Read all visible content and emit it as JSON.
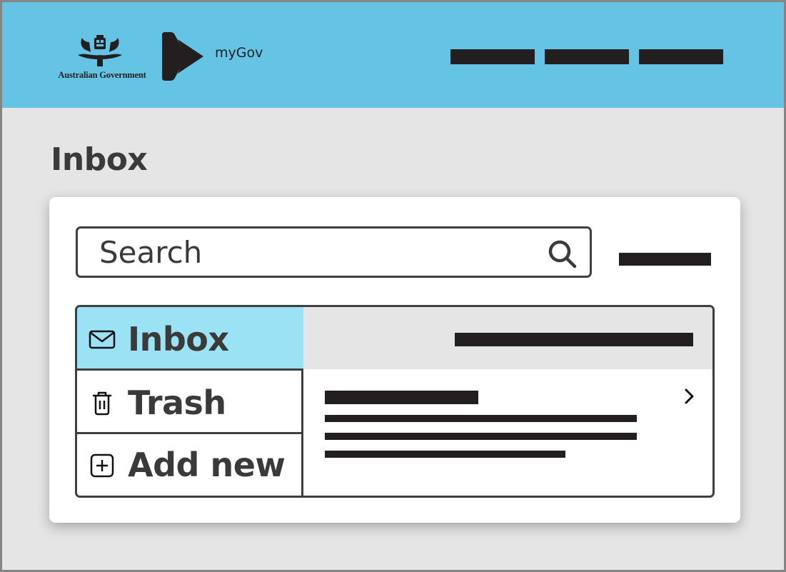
{
  "header": {
    "government_label": "Australian Government",
    "brand_name": "myGov",
    "background_color": "#65c4e4",
    "nav_items": [
      {
        "icon": "redacted-nav-link"
      },
      {
        "icon": "redacted-nav-link"
      },
      {
        "icon": "redacted-nav-link"
      }
    ]
  },
  "page": {
    "title": "Inbox"
  },
  "search": {
    "placeholder": "Search",
    "value": "",
    "icon": "search-icon"
  },
  "folders": [
    {
      "label": "Inbox",
      "icon": "envelope-icon",
      "active": true
    },
    {
      "label": "Trash",
      "icon": "trash-icon",
      "active": false
    },
    {
      "label": "Add new",
      "icon": "plus-square-icon",
      "active": false
    }
  ],
  "colors": {
    "active_folder": "#9ae2f4",
    "text": "#3a3a3a",
    "redaction": "#231f20",
    "page_background": "#e5e5e5"
  },
  "message_list": {
    "header": "redacted-heading",
    "items": [
      {
        "title": "redacted-title",
        "preview_lines": 3,
        "icon": "chevron-right-icon"
      }
    ]
  }
}
